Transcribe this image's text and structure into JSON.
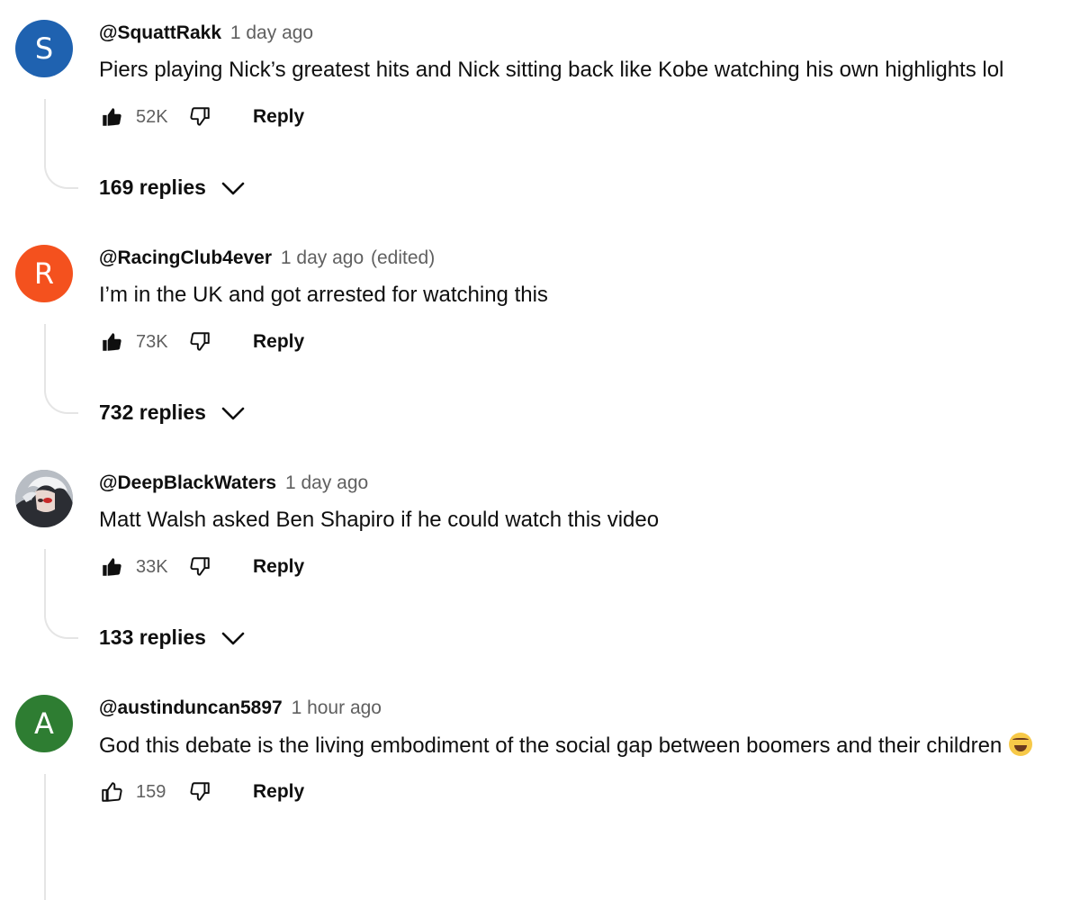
{
  "comments": [
    {
      "avatar_letter": "S",
      "avatar_color": "#1f62b0",
      "handle": "@SquattRakk",
      "time": "1 day ago",
      "edited": "",
      "text": "Piers playing Nick’s greatest hits and Nick sitting back like Kobe watching his own highlights lol",
      "likes": "52K",
      "like_icon": "thumbs-up-filled",
      "dislike_icon": "thumbs-down-outline",
      "reply_label": "Reply",
      "replies_label": "169 replies"
    },
    {
      "avatar_letter": "R",
      "avatar_color": "#f4511e",
      "handle": "@RacingClub4ever",
      "time": "1 day ago",
      "edited": "(edited)",
      "text": "I’m in the UK and got arrested for watching this",
      "likes": "73K",
      "like_icon": "thumbs-up-filled",
      "dislike_icon": "thumbs-down-outline",
      "reply_label": "Reply",
      "replies_label": "732 replies"
    },
    {
      "avatar_letter": "",
      "avatar_color": "#9aa0a6",
      "handle": "@DeepBlackWaters",
      "time": "1 day ago",
      "edited": "",
      "text": "Matt Walsh asked Ben Shapiro if he could watch this video",
      "likes": "33K",
      "like_icon": "thumbs-up-filled",
      "dislike_icon": "thumbs-down-outline",
      "reply_label": "Reply",
      "replies_label": "133 replies"
    },
    {
      "avatar_letter": "A",
      "avatar_color": "#2e7d32",
      "handle": "@austinduncan5897",
      "time": "1 hour ago",
      "edited": "",
      "text": "God this debate is the living embodiment of the social gap between boomers and their children",
      "emoji": "face-with-tears-of-joy-emoji",
      "likes": "159",
      "like_icon": "thumbs-up-outline",
      "dislike_icon": "thumbs-down-outline",
      "reply_label": "Reply"
    }
  ]
}
